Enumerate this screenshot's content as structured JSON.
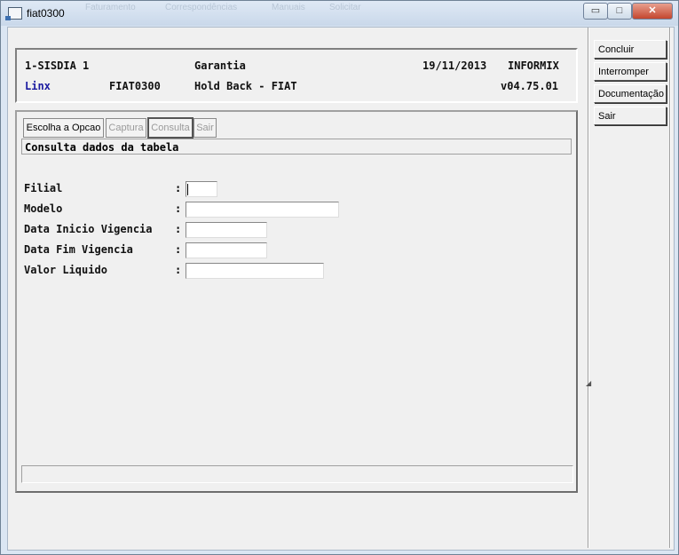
{
  "window": {
    "title": "fiat0300",
    "background_menu": [
      "Faturamento",
      "Correspondências",
      "Manuais",
      "Solicitar"
    ],
    "controls": {
      "minimize": "▭",
      "maximize": "□",
      "close": "✕"
    }
  },
  "header": {
    "system": "1-SISDIA 1",
    "module": "Garantia",
    "date": "19/11/2013",
    "db": "INFORMIX",
    "company": "Linx",
    "program": "FIAT0300",
    "screen_title": "Hold Back - FIAT",
    "version": "v04.75.01"
  },
  "toolbar": {
    "escolha": "Escolha a Opcao",
    "captura": "Captura",
    "consulta": "Consulta",
    "sair": "Sair"
  },
  "message": "Consulta dados da tabela",
  "form": {
    "fields": [
      {
        "label": "Filial",
        "value": ""
      },
      {
        "label": "Modelo",
        "value": ""
      },
      {
        "label": "Data Inicio Vigencia",
        "value": ""
      },
      {
        "label": "Data Fim Vigencia",
        "value": ""
      },
      {
        "label": "Valor Liquido",
        "value": ""
      }
    ],
    "colon": ":"
  },
  "side_buttons": [
    "Concluir",
    "Interromper",
    "Documentação",
    "Sair"
  ],
  "colors": {
    "link_blue": "#1a1aa0",
    "title_gradient_top": "#dfe9f5"
  }
}
